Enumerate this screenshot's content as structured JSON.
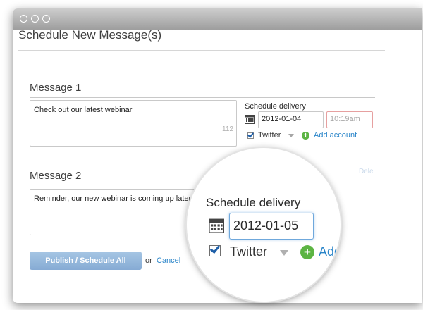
{
  "page": {
    "title": "Schedule New Message(s)"
  },
  "messages": [
    {
      "heading": "Message 1",
      "text": "Check out our latest webinar",
      "char_count": "112",
      "schedule_label": "Schedule delivery",
      "date": "2012-01-04",
      "time": "10:19am",
      "network": "Twitter",
      "add_account": "Add account"
    },
    {
      "heading": "Message 2",
      "text": "Reminder, our new webinar is coming up later this week",
      "delete_label": "Dele"
    }
  ],
  "magnifier": {
    "schedule_label": "Schedule delivery",
    "date": "2012-01-05",
    "network": "Twitter",
    "add_label": "Add",
    "account_fragment": "ount",
    "am_fragment": "am"
  },
  "actions": {
    "publish_label": "Publish / Schedule All",
    "or_text": "or",
    "cancel_label": "Cancel"
  },
  "colors": {
    "link": "#2a85c9",
    "publish_button": "#97b8dc",
    "add_icon": "#5cb443",
    "time_error_border": "#e6a0a0"
  },
  "icons": {
    "calendar": "calendar-icon",
    "add": "plus-circle-icon",
    "dropdown": "chevron-down-icon",
    "checkbox": "check-icon"
  }
}
